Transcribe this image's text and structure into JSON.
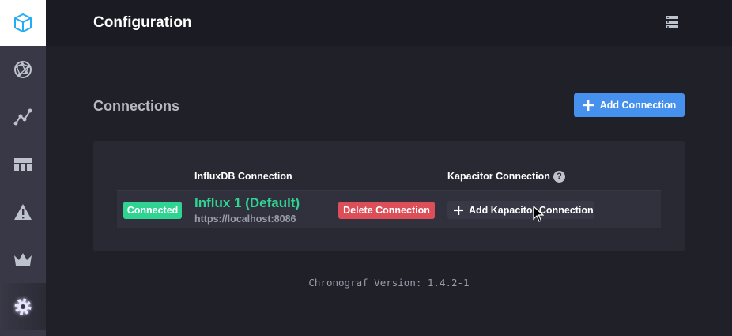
{
  "header": {
    "title": "Configuration"
  },
  "sidebar": {
    "items": [
      {
        "icon": "cube-logo-icon"
      },
      {
        "icon": "globe-network-icon"
      },
      {
        "icon": "graph-line-icon"
      },
      {
        "icon": "dashboard-grid-icon"
      },
      {
        "icon": "alert-triangle-icon"
      },
      {
        "icon": "crown-icon"
      },
      {
        "icon": "gear-icon",
        "active": true
      }
    ]
  },
  "connections": {
    "title": "Connections",
    "add_button": "Add Connection",
    "influx_header": "InfluxDB Connection",
    "kapacitor_header": "Kapacitor Connection",
    "help_glyph": "?",
    "rows": [
      {
        "status": "Connected",
        "name": "Influx 1 (Default)",
        "url": "https://localhost:8086",
        "delete_label": "Delete Connection",
        "add_kapacitor_label": "Add Kapacitor Connection"
      }
    ]
  },
  "footer": {
    "version": "Chronograf Version: 1.4.2-1"
  },
  "colors": {
    "accent_blue": "#4591ed",
    "success_green": "#2fd493",
    "danger_red": "#dc4e58",
    "sidebar_bg": "#383846",
    "header_bg": "#1b1b23",
    "active_glow": "#8e91fc"
  }
}
